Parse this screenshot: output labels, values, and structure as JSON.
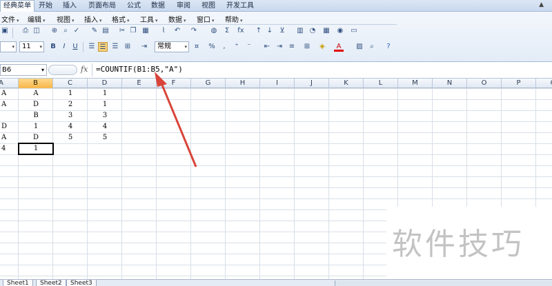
{
  "ribbon": {
    "tabs": [
      "经典菜单",
      "开始",
      "插入",
      "页面布局",
      "公式",
      "数据",
      "审阅",
      "视图",
      "开发工具"
    ],
    "active_tab": 0
  },
  "menu": {
    "items": [
      "文件",
      "编辑",
      "视图",
      "插入",
      "格式",
      "工具",
      "数据",
      "窗口",
      "帮助"
    ]
  },
  "toolbar": {
    "font_size": "11",
    "number_format": "常规",
    "percent": "%",
    "comma": ",",
    "sum": "Σ",
    "fx": "fx"
  },
  "formula_bar": {
    "name_box": "B6",
    "fx_label": "fx",
    "formula": "=COUNTIF(B1:B5,\"A\")"
  },
  "grid": {
    "columns": [
      "A",
      "B",
      "C",
      "D",
      "E",
      "F",
      "G",
      "H",
      "I",
      "J",
      "K",
      "L",
      "M",
      "N",
      "O",
      "P",
      "Q"
    ],
    "selected_column": "B",
    "rows": [
      [
        "A",
        "A",
        "1",
        "1"
      ],
      [
        "A",
        "D",
        "2",
        "1"
      ],
      [
        "",
        "B",
        "3",
        "3"
      ],
      [
        "D",
        "1",
        "4",
        "4"
      ],
      [
        "A",
        "D",
        "5",
        "5"
      ],
      [
        "4",
        "1",
        "",
        ""
      ]
    ]
  },
  "sheets": [
    "Sheet1",
    "Sheet2",
    "Sheet3"
  ],
  "watermark": "软件技巧",
  "colors": {
    "arrow": "#d9443a",
    "selected_header": "#f6b64b"
  }
}
